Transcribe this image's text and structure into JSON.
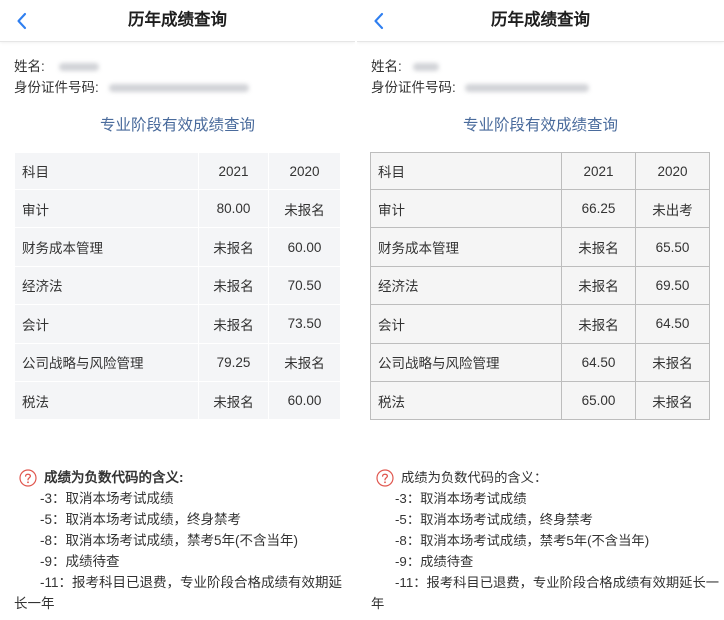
{
  "theme": {
    "accent": "#2f7ff0",
    "section_title_color": "#4a6b9c",
    "text_color": "#333333",
    "note_icon_color": "#e0574f",
    "header_border": "#e6e6e6"
  },
  "panels": [
    {
      "header": {
        "back_icon": "chevron-left-icon",
        "title": "历年成绩查询"
      },
      "profile": {
        "name_label": "姓名:",
        "id_label": "身份证件号码:"
      },
      "section_title": "专业阶段有效成绩查询",
      "table": {
        "border_color": "#ffffff",
        "cell_bg": "#f4f5f7",
        "columns": [
          "科目",
          "2021",
          "2020"
        ],
        "rows": [
          [
            "审计",
            "80.00",
            "未报名"
          ],
          [
            "财务成本管理",
            "未报名",
            "60.00"
          ],
          [
            "经济法",
            "未报名",
            "70.50"
          ],
          [
            "会计",
            "未报名",
            "73.50"
          ],
          [
            "公司战略与风险管理",
            "79.25",
            "未报名"
          ],
          [
            "税法",
            "未报名",
            "60.00"
          ]
        ]
      },
      "notes": {
        "icon": "question-circle-icon",
        "heading": "成绩为负数代码的含义:",
        "items": [
          "-3：取消本场考试成绩",
          "-5：取消本场考试成绩，终身禁考",
          "-8：取消本场考试成绩，禁考5年(不含当年)",
          "-9：成绩待查",
          "-11：报考科目已退费，专业阶段合格成绩有效期延长一年"
        ]
      }
    },
    {
      "header": {
        "back_icon": "chevron-left-icon",
        "title": "历年成绩查询"
      },
      "profile": {
        "name_label": "姓名:",
        "id_label": "身份证件号码:"
      },
      "section_title": "专业阶段有效成绩查询",
      "table": {
        "border_color": "#bdbdbd",
        "cell_bg": "#f5f5f5",
        "columns": [
          "科目",
          "2021",
          "2020"
        ],
        "rows": [
          [
            "审计",
            "66.25",
            "未出考"
          ],
          [
            "财务成本管理",
            "未报名",
            "65.50"
          ],
          [
            "经济法",
            "未报名",
            "69.50"
          ],
          [
            "会计",
            "未报名",
            "64.50"
          ],
          [
            "公司战略与风险管理",
            "64.50",
            "未报名"
          ],
          [
            "税法",
            "65.00",
            "未报名"
          ]
        ]
      },
      "notes": {
        "icon": "question-circle-icon",
        "heading": "成绩为负数代码的含义：",
        "items": [
          "-3：取消本场考试成绩",
          "-5：取消本场考试成绩，终身禁考",
          "-8：取消本场考试成绩，禁考5年(不含当年)",
          "-9：成绩待查",
          "-11：报考科目已退费，专业阶段合格成绩有效期延长一年"
        ]
      }
    }
  ]
}
